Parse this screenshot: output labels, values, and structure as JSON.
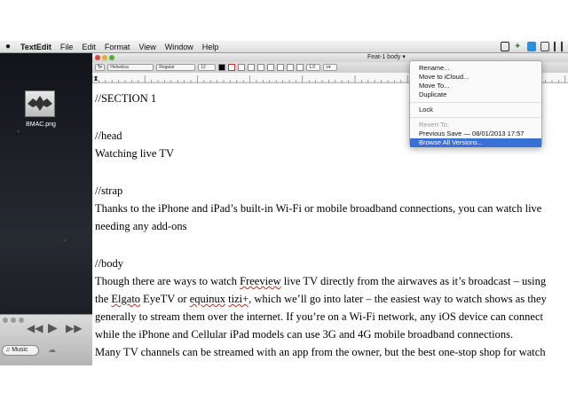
{
  "menubar": {
    "apple": "",
    "items": [
      "TextEdit",
      "File",
      "Edit",
      "Format",
      "View",
      "Window",
      "Help"
    ]
  },
  "desktop": {
    "icon_label": "BMAC.png"
  },
  "itunes": {
    "music_label": "Music"
  },
  "window": {
    "title": "Feat-1 body",
    "toolbar": {
      "font_family": "Helvetica",
      "font_style": "Regular",
      "font_size": "12",
      "spacing": "1.0"
    }
  },
  "document": {
    "lines": [
      "//SECTION 1",
      "//head",
      "Watching live TV",
      "//strap",
      "Thanks to the iPhone and iPad’s built-in Wi-Fi or mobile broadband connections, you can watch live",
      "needing any add-ons",
      "//body",
      "Though there are ways to watch",
      "Freeview",
      "live TV directly from the airwaves as it’s broadcast – using",
      "the",
      "Elgato",
      "EyeTV or",
      "equinux",
      "tizi+",
      ", which we’ll go into later – the easiest way to watch shows as they",
      "generally to stream them over the internet. If you’re on a Wi-Fi network, any iOS device can connect",
      "while the iPhone and Cellular iPad models can use 3G and 4G mobile broadband connections.",
      "Many TV channels can be streamed with an app from the owner, but the best one-stop shop for watch"
    ]
  },
  "popup": {
    "items": [
      {
        "label": "Rename..."
      },
      {
        "label": "Move to iCloud..."
      },
      {
        "label": "Move To..."
      },
      {
        "label": "Duplicate"
      },
      {
        "label": "Lock"
      },
      {
        "label": "Revert To:"
      },
      {
        "label": "Previous Save — 08/01/2013 17:57"
      },
      {
        "label": "Browse All Versions..."
      }
    ]
  },
  "colors": {
    "highlight": "#3a6fd8",
    "spell_underline": "#d22222"
  }
}
